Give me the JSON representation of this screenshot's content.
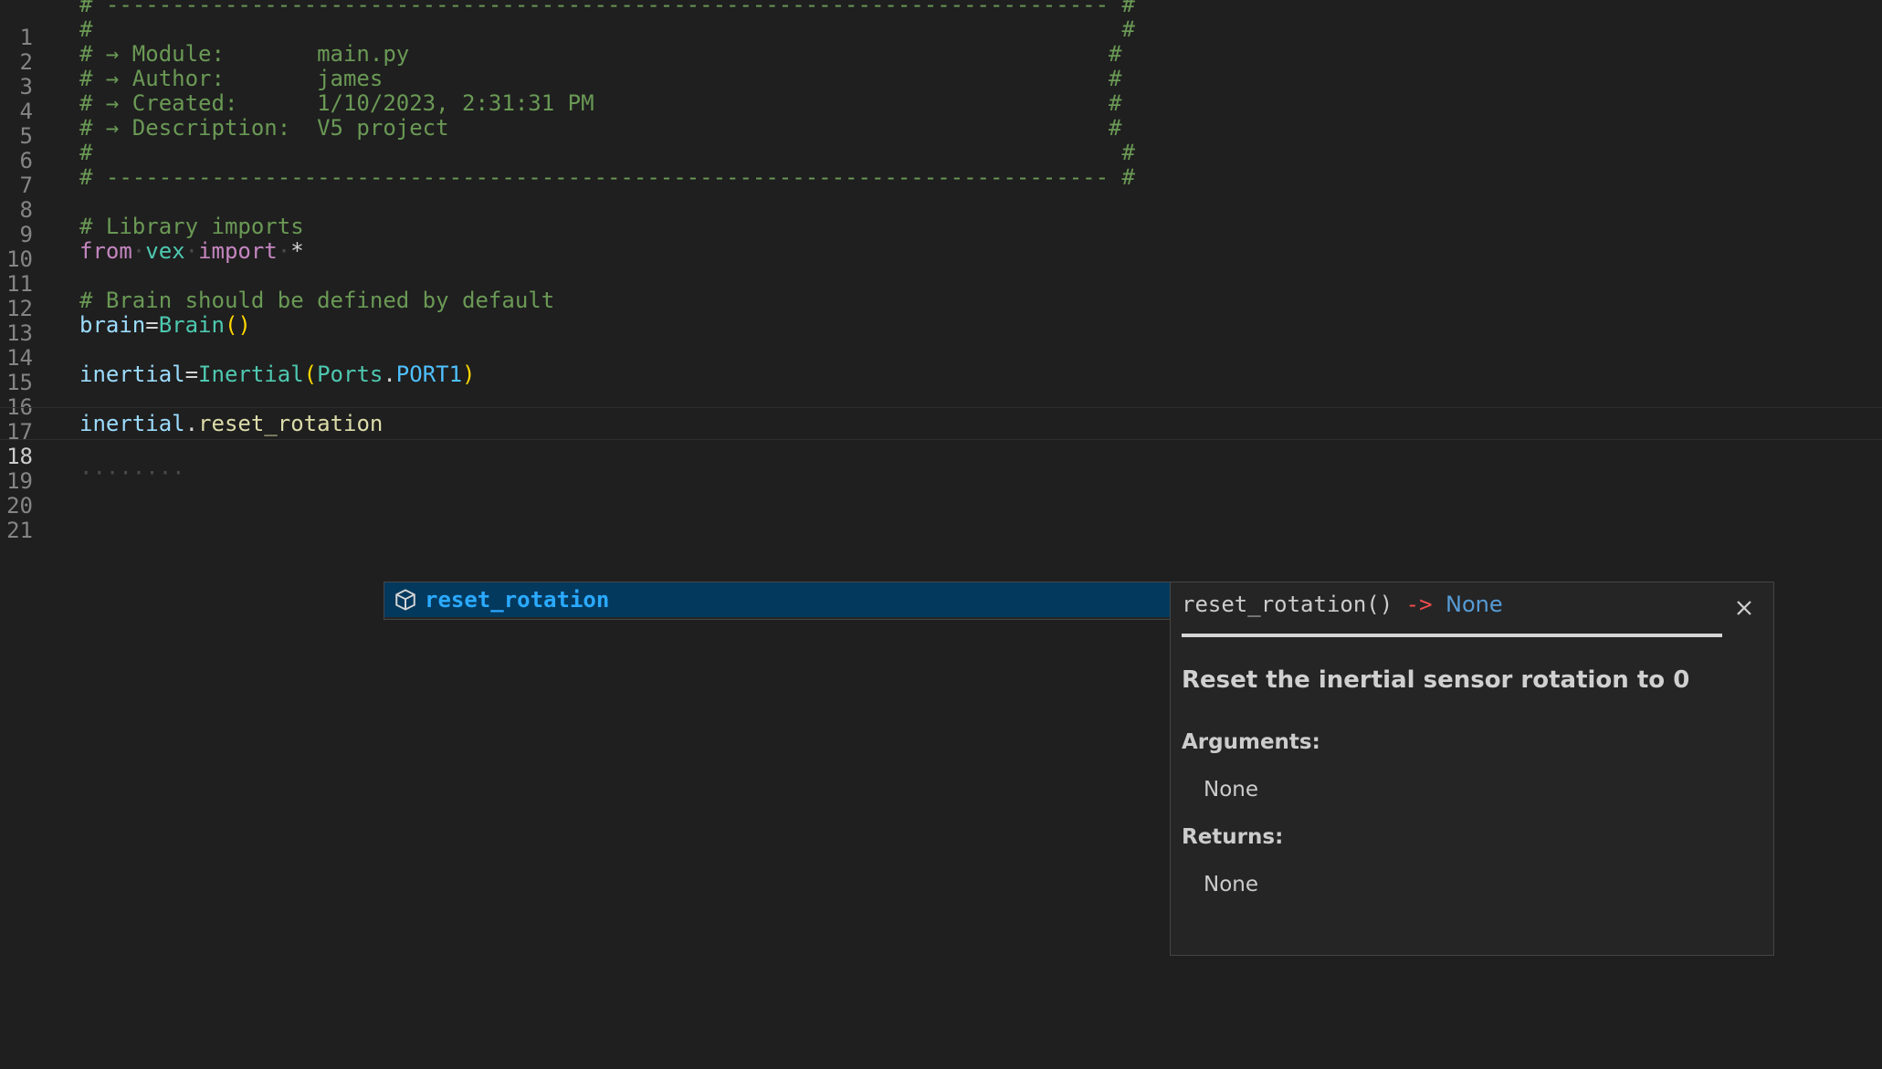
{
  "editor": {
    "active_line": 18,
    "lines": [
      {
        "n": "1",
        "t": "# ---------------------------------------------------------------------------- #"
      },
      {
        "n": "2",
        "t": "#                                                                              #"
      },
      {
        "n": "3",
        "t": "# → Module:       main.py                                                     #"
      },
      {
        "n": "4",
        "t": "# → Author:       james                                                       #"
      },
      {
        "n": "5",
        "t": "# → Created:      1/10/2023, 2:31:31 PM                                       #"
      },
      {
        "n": "6",
        "t": "# → Description:  V5 project                                                  #"
      },
      {
        "n": "7",
        "t": "#                                                                              #"
      },
      {
        "n": "8",
        "t": "# ---------------------------------------------------------------------------- #"
      },
      {
        "n": "9",
        "t": ""
      },
      {
        "n": "10",
        "t": "# Library imports"
      },
      {
        "n": "11",
        "t": "from vex import *"
      },
      {
        "n": "12",
        "t": ""
      },
      {
        "n": "13",
        "t": "# Brain should be defined by default"
      },
      {
        "n": "14",
        "t": "brain=Brain()"
      },
      {
        "n": "15",
        "t": ""
      },
      {
        "n": "16",
        "t": "inertial=Inertial(Ports.PORT1)"
      },
      {
        "n": "17",
        "t": ""
      },
      {
        "n": "18",
        "t": "inertial.reset_rotation"
      },
      {
        "n": "19",
        "t": ""
      },
      {
        "n": "20",
        "t": "        "
      },
      {
        "n": "21",
        "t": ""
      }
    ]
  },
  "suggest": {
    "item_label": "reset_rotation",
    "item_icon": "method-cube-icon"
  },
  "details": {
    "signature_name": "reset_rotation()",
    "signature_arrow": "->",
    "signature_return": "None",
    "summary": "Reset the inertial sensor rotation to 0",
    "arguments_label": "Arguments:",
    "arguments_value": "None",
    "returns_label": "Returns:",
    "returns_value": "None"
  },
  "colors": {
    "background": "#1f1f1f",
    "comment": "#6a9955",
    "keyword": "#c586c0",
    "class": "#4ec9b0",
    "variable": "#9cdcfe",
    "function": "#dcdcaa",
    "suggest_selected": "#04395e",
    "suggest_text": "#2aaaff",
    "arrow": "#f14c4c",
    "return_type": "#569cd6"
  }
}
